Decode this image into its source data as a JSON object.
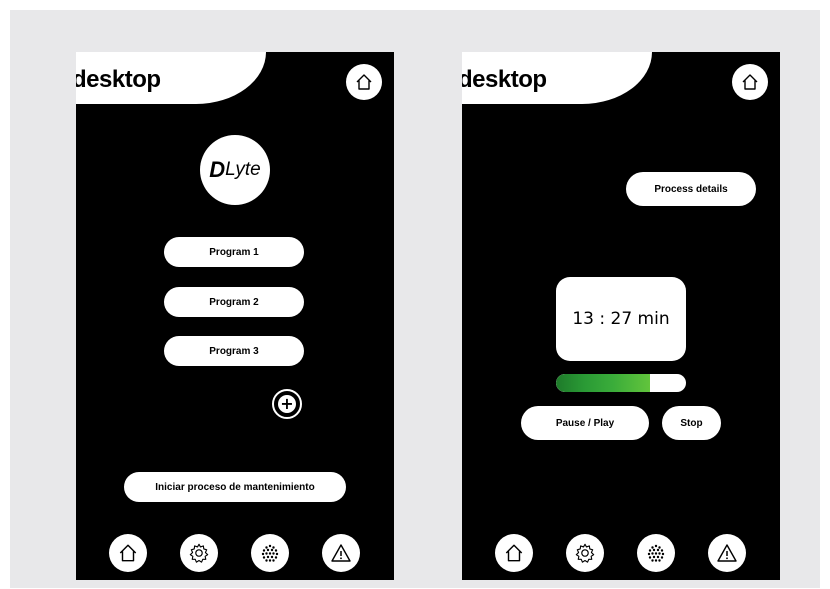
{
  "left_screen": {
    "brand": "desktop",
    "logo": {
      "d": "D",
      "rest": "Lyte"
    },
    "programs": [
      "Program 1",
      "Program 2",
      "Program 3"
    ],
    "add_label": "+",
    "maintenance_label": "Iniciar proceso de mantenimiento",
    "nav": [
      "home-icon",
      "gear-icon",
      "sponge-icon",
      "warning-icon"
    ]
  },
  "right_screen": {
    "brand": "desktop",
    "details_label": "Process details",
    "timer": "13 : 27 min",
    "progress": 0.72,
    "pause_label": "Pause / Play",
    "stop_label": "Stop",
    "nav": [
      "home-icon",
      "gear-icon",
      "sponge-icon",
      "warning-icon"
    ]
  },
  "colors": {
    "background": "#e8e8ea",
    "screen": "#000000",
    "progress_fill": "#3aac3a"
  }
}
